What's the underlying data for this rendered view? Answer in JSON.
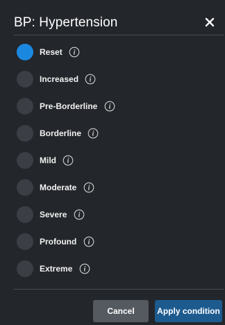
{
  "dialog": {
    "title": "BP: Hypertension",
    "close_icon": "close-icon"
  },
  "options": [
    {
      "label": "Reset",
      "selected": true
    },
    {
      "label": "Increased",
      "selected": false
    },
    {
      "label": "Pre-Borderline",
      "selected": false
    },
    {
      "label": "Borderline",
      "selected": false
    },
    {
      "label": "Mild",
      "selected": false
    },
    {
      "label": "Moderate",
      "selected": false
    },
    {
      "label": "Severe",
      "selected": false
    },
    {
      "label": "Profound",
      "selected": false
    },
    {
      "label": "Extreme",
      "selected": false
    }
  ],
  "info_icon": "info-icon",
  "footer": {
    "cancel_label": "Cancel",
    "apply_label": "Apply condition"
  },
  "colors": {
    "background": "#23262b",
    "selected_radio": "#1b88e0",
    "unselected_radio": "#3b3f45",
    "cancel_button": "#555a61",
    "apply_button": "#1d5b8f"
  }
}
